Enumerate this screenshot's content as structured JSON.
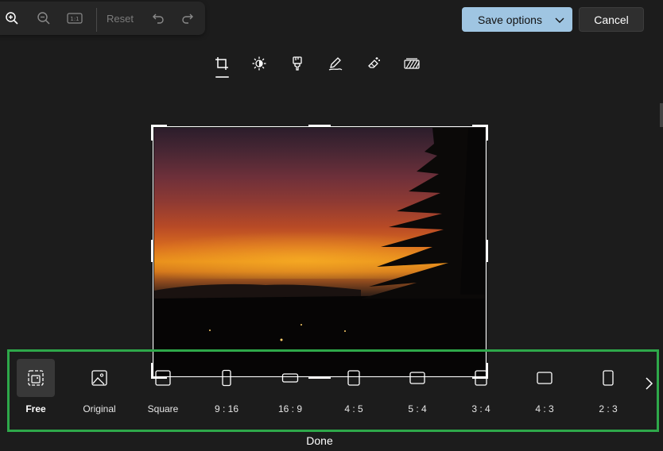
{
  "zoom_toolbar": {
    "reset_label": "Reset",
    "icons": [
      "zoom-in-icon",
      "zoom-out-icon",
      "actual-size-icon",
      "undo-icon",
      "redo-icon"
    ],
    "actual_size_text": "1:1"
  },
  "header": {
    "save_label": "Save options",
    "cancel_label": "Cancel"
  },
  "tools": [
    "crop-icon",
    "adjust-icon",
    "filter-icon",
    "markup-icon",
    "erase-icon",
    "background-icon"
  ],
  "aspect_ratios": [
    {
      "label": "Free",
      "selected": true,
      "icon": "free-crop-icon"
    },
    {
      "label": "Original",
      "selected": false,
      "icon": "image-icon"
    },
    {
      "label": "Square",
      "selected": false,
      "icon": "square-icon"
    },
    {
      "label": "9 : 16",
      "selected": false,
      "icon": "portrait-icon"
    },
    {
      "label": "16 : 9",
      "selected": false,
      "icon": "landscape-icon"
    },
    {
      "label": "4 : 5",
      "selected": false,
      "icon": "portrait-icon"
    },
    {
      "label": "5 : 4",
      "selected": false,
      "icon": "landscape-icon"
    },
    {
      "label": "3 : 4",
      "selected": false,
      "icon": "portrait-icon"
    },
    {
      "label": "4 : 3",
      "selected": false,
      "icon": "landscape-icon"
    },
    {
      "label": "2 : 3",
      "selected": false,
      "icon": "portrait-icon"
    }
  ],
  "footer": {
    "done_label": "Done"
  },
  "colors": {
    "background": "#1c1c1c",
    "accent": "#9fc5e2",
    "highlight": "#2ea84a"
  }
}
